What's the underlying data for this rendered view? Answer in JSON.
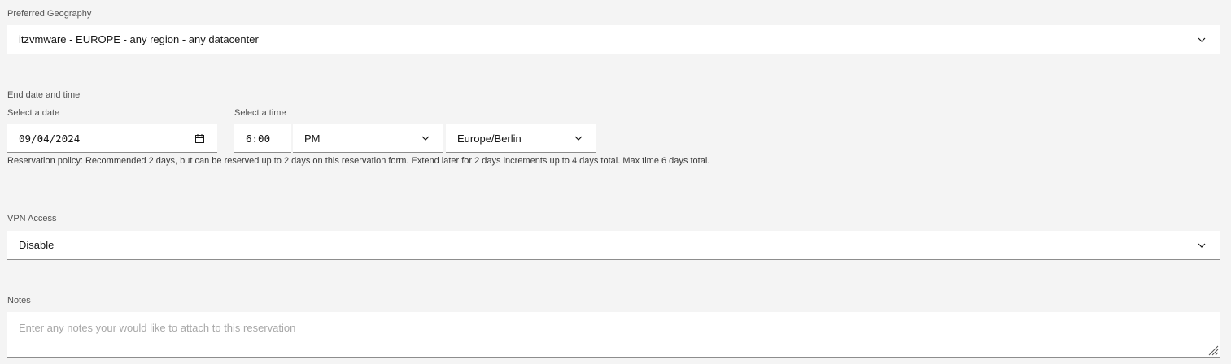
{
  "geography": {
    "label": "Preferred Geography",
    "value": "itzvmware - EUROPE - any region - any datacenter",
    "icon": "chevron-down-icon"
  },
  "end_datetime": {
    "section_label": "End date and time",
    "date_label": "Select a date",
    "date_value": "09/04/2024",
    "date_icon": "calendar-icon",
    "time_label": "Select a time",
    "time_value": "6:00",
    "ampm_value": "PM",
    "timezone_value": "Europe/Berlin",
    "policy_text": "Reservation policy: Recommended 2 days, but can be reserved up to 2 days on this reservation form. Extend later for 2 days increments up to 4 days total. Max time 6 days total."
  },
  "vpn": {
    "label": "VPN Access",
    "value": "Disable",
    "icon": "chevron-down-icon"
  },
  "notes": {
    "label": "Notes",
    "placeholder": "Enter any notes your would like to attach to this reservation"
  }
}
